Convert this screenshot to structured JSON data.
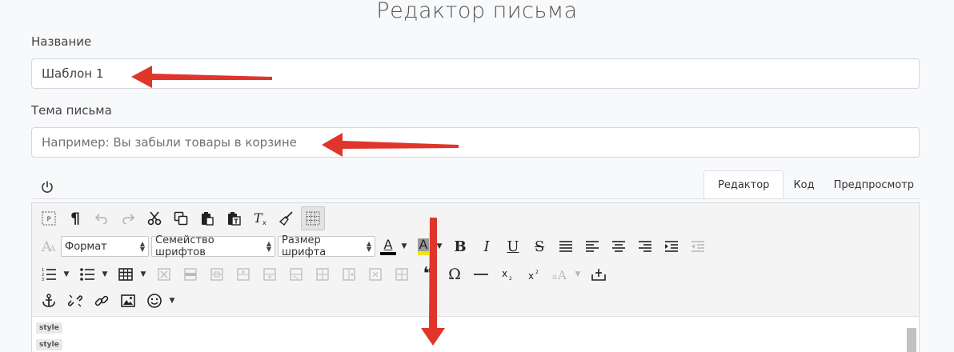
{
  "page": {
    "title": "Редактор письма"
  },
  "form": {
    "name_label": "Название",
    "name_value": "Шаблон 1",
    "subject_label": "Тема письма",
    "subject_placeholder": "Например: Вы забыли товары в корзине"
  },
  "tabs": [
    {
      "label": "Редактор",
      "active": true
    },
    {
      "label": "Код",
      "active": false
    },
    {
      "label": "Предпросмотр",
      "active": false
    }
  ],
  "toolbar": {
    "format_select": "Формат",
    "font_family_select": "Семейство шрифтов",
    "font_size_select": "Размер шрифта",
    "text_color_letter": "A",
    "bg_color_letter": "A",
    "bold": "B",
    "italic": "I",
    "underline": "U",
    "strike": "S",
    "paragraph": "¶",
    "omega": "Ω",
    "quote": "❝",
    "icons": [
      "show-blocks-icon",
      "paragraph-icon",
      "undo-icon",
      "redo-icon",
      "cut-icon",
      "copy-icon",
      "paste-icon",
      "paste-text-icon",
      "clear-format-icon",
      "clean-icon",
      "table-grid-icon"
    ]
  },
  "editor_body": {
    "tags": [
      "style",
      "style"
    ]
  },
  "colors": {
    "text_color_bar": "#000000",
    "bg_color_bar": "#f5e11a",
    "arrow": "#e0352b"
  }
}
